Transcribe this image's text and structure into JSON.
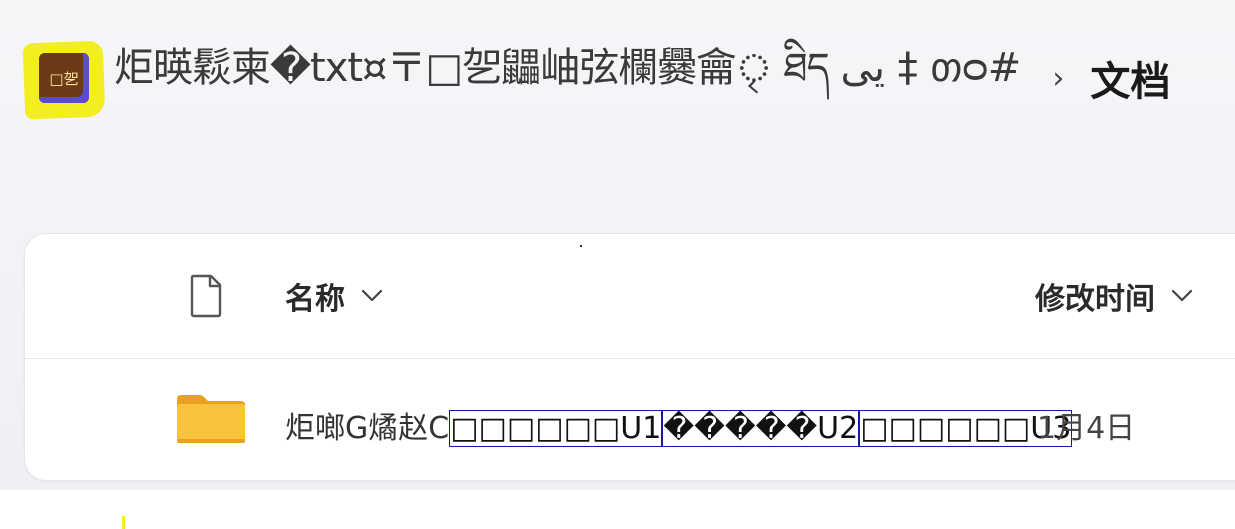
{
  "breadcrumb": {
    "avatar_glyph": "□乫",
    "root_label": "炬暎鬏柬�txt¤〒□乫鼺岫弦欄爨龠ৃ ཐིད يى ‡ თᴑ#",
    "separator": "›",
    "current_label": "文档"
  },
  "file_list": {
    "columns": {
      "name": "名称",
      "modified": "修改时间"
    },
    "rows": [
      {
        "name_prefix": "炬啷G燏赵C",
        "name_part1": "□□□□□□U1",
        "name_part2": "�����U2",
        "name_part3": "□□□□□□U3",
        "modified": "1月4日"
      }
    ]
  },
  "colors": {
    "highlight": "#f3ee1f",
    "folder": "#f7b52c",
    "avatar_bg": "#6b3a16",
    "avatar_accent": "#5b4bd0"
  },
  "icons": {
    "file_type": "file-icon",
    "folder": "folder-icon",
    "sort": "chevron-down-icon"
  }
}
